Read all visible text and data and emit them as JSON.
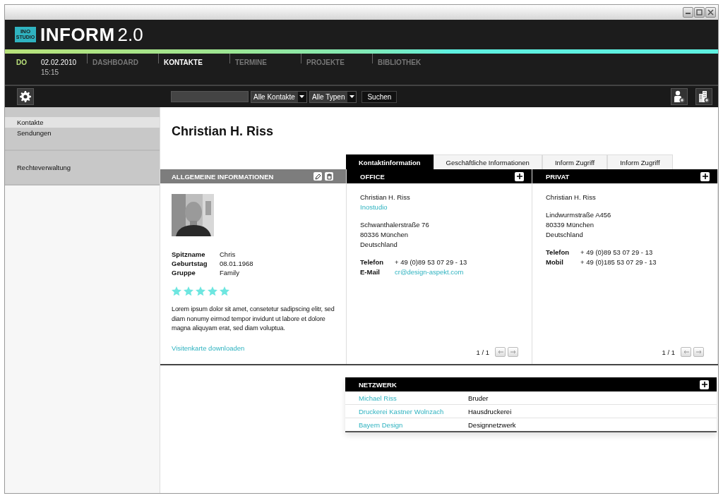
{
  "app": {
    "badge": [
      "INO",
      "STUDIO"
    ],
    "title": "INFORM",
    "version": "2.0"
  },
  "datebar": {
    "day": "DO",
    "date": "02.02.2010",
    "time": "15:15"
  },
  "nav": [
    {
      "label": "DASHBOARD",
      "selected": false
    },
    {
      "label": "KONTAKTE",
      "selected": true
    },
    {
      "label": "TERMINE",
      "selected": false
    },
    {
      "label": "PROJEKTE",
      "selected": false
    },
    {
      "label": "BIBLIOTHEK",
      "selected": false
    }
  ],
  "toolbar": {
    "filters": [
      "Alle Kontakte",
      "Alle Typen"
    ],
    "search_button": "Suchen"
  },
  "sidebar": {
    "groups": [
      [
        {
          "label": "Kontakte",
          "selected": true
        },
        {
          "label": "Sendungen",
          "selected": false
        }
      ],
      [
        {
          "label": "Rechteverwaltung",
          "selected": false
        }
      ]
    ]
  },
  "contact": {
    "name": "Christian H. Riss"
  },
  "general": {
    "heading": "ALLGEMEINE INFORMATIONEN",
    "fields": [
      {
        "label": "Spitzname",
        "value": "Chris"
      },
      {
        "label": "Geburtstag",
        "value": "08.01.1968"
      },
      {
        "label": "Gruppe",
        "value": "Family"
      }
    ],
    "stars": 5,
    "description": "Lorem ipsum dolor sit amet, consetetur sadipscing elitr, sed diam nonumy eirmod tempor invidunt ut labore et dolore magna aliquyam erat, sed diam voluptua.",
    "link": "Visitenkarte downloaden"
  },
  "tabs": [
    {
      "label": "Kontaktinformation",
      "selected": true
    },
    {
      "label": "Geschäftliche Informationen",
      "selected": false
    },
    {
      "label": "Inform Zugriff",
      "selected": false
    },
    {
      "label": "Inform Zugriff",
      "selected": false
    }
  ],
  "cards": [
    {
      "heading": "OFFICE",
      "blocks": [
        [
          {
            "text": "Christian H. Riss",
            "kind": "text"
          },
          {
            "text": "Inostudio",
            "kind": "link"
          }
        ],
        [
          {
            "text": "Schwanthalerstraße 76",
            "kind": "text"
          },
          {
            "text": "80336 München",
            "kind": "text"
          },
          {
            "text": "Deutschland",
            "kind": "text"
          }
        ]
      ],
      "fields": [
        {
          "label": "Telefon",
          "value": "+ 49 (0)89 53 07 29 - 13",
          "kind": "text"
        },
        {
          "label": "E-Mail",
          "value": "cr@design-aspekt.com",
          "kind": "link"
        }
      ],
      "pager": "1 / 1"
    },
    {
      "heading": "PRIVAT",
      "blocks": [
        [
          {
            "text": "Christian H. Riss",
            "kind": "text"
          }
        ],
        [
          {
            "text": "Lindwurmstraße A456",
            "kind": "text"
          },
          {
            "text": "80339 München",
            "kind": "text"
          },
          {
            "text": "Deutschland",
            "kind": "text"
          }
        ]
      ],
      "fields": [
        {
          "label": "Telefon",
          "value": "+ 49 (0)89 53 07 29 - 13",
          "kind": "text"
        },
        {
          "label": "Mobil",
          "value": "+ 49 (0)185 53 07 29 - 13",
          "kind": "text"
        }
      ],
      "pager": "1 / 1"
    }
  ],
  "network": {
    "heading": "NETZWERK",
    "rows": [
      {
        "name": "Michael Riss",
        "relation": "Bruder"
      },
      {
        "name": "Druckerei Kastner Wolnzach",
        "relation": "Hausdruckerei"
      },
      {
        "name": "Bayern Design",
        "relation": "Designnetzwerk"
      }
    ]
  }
}
